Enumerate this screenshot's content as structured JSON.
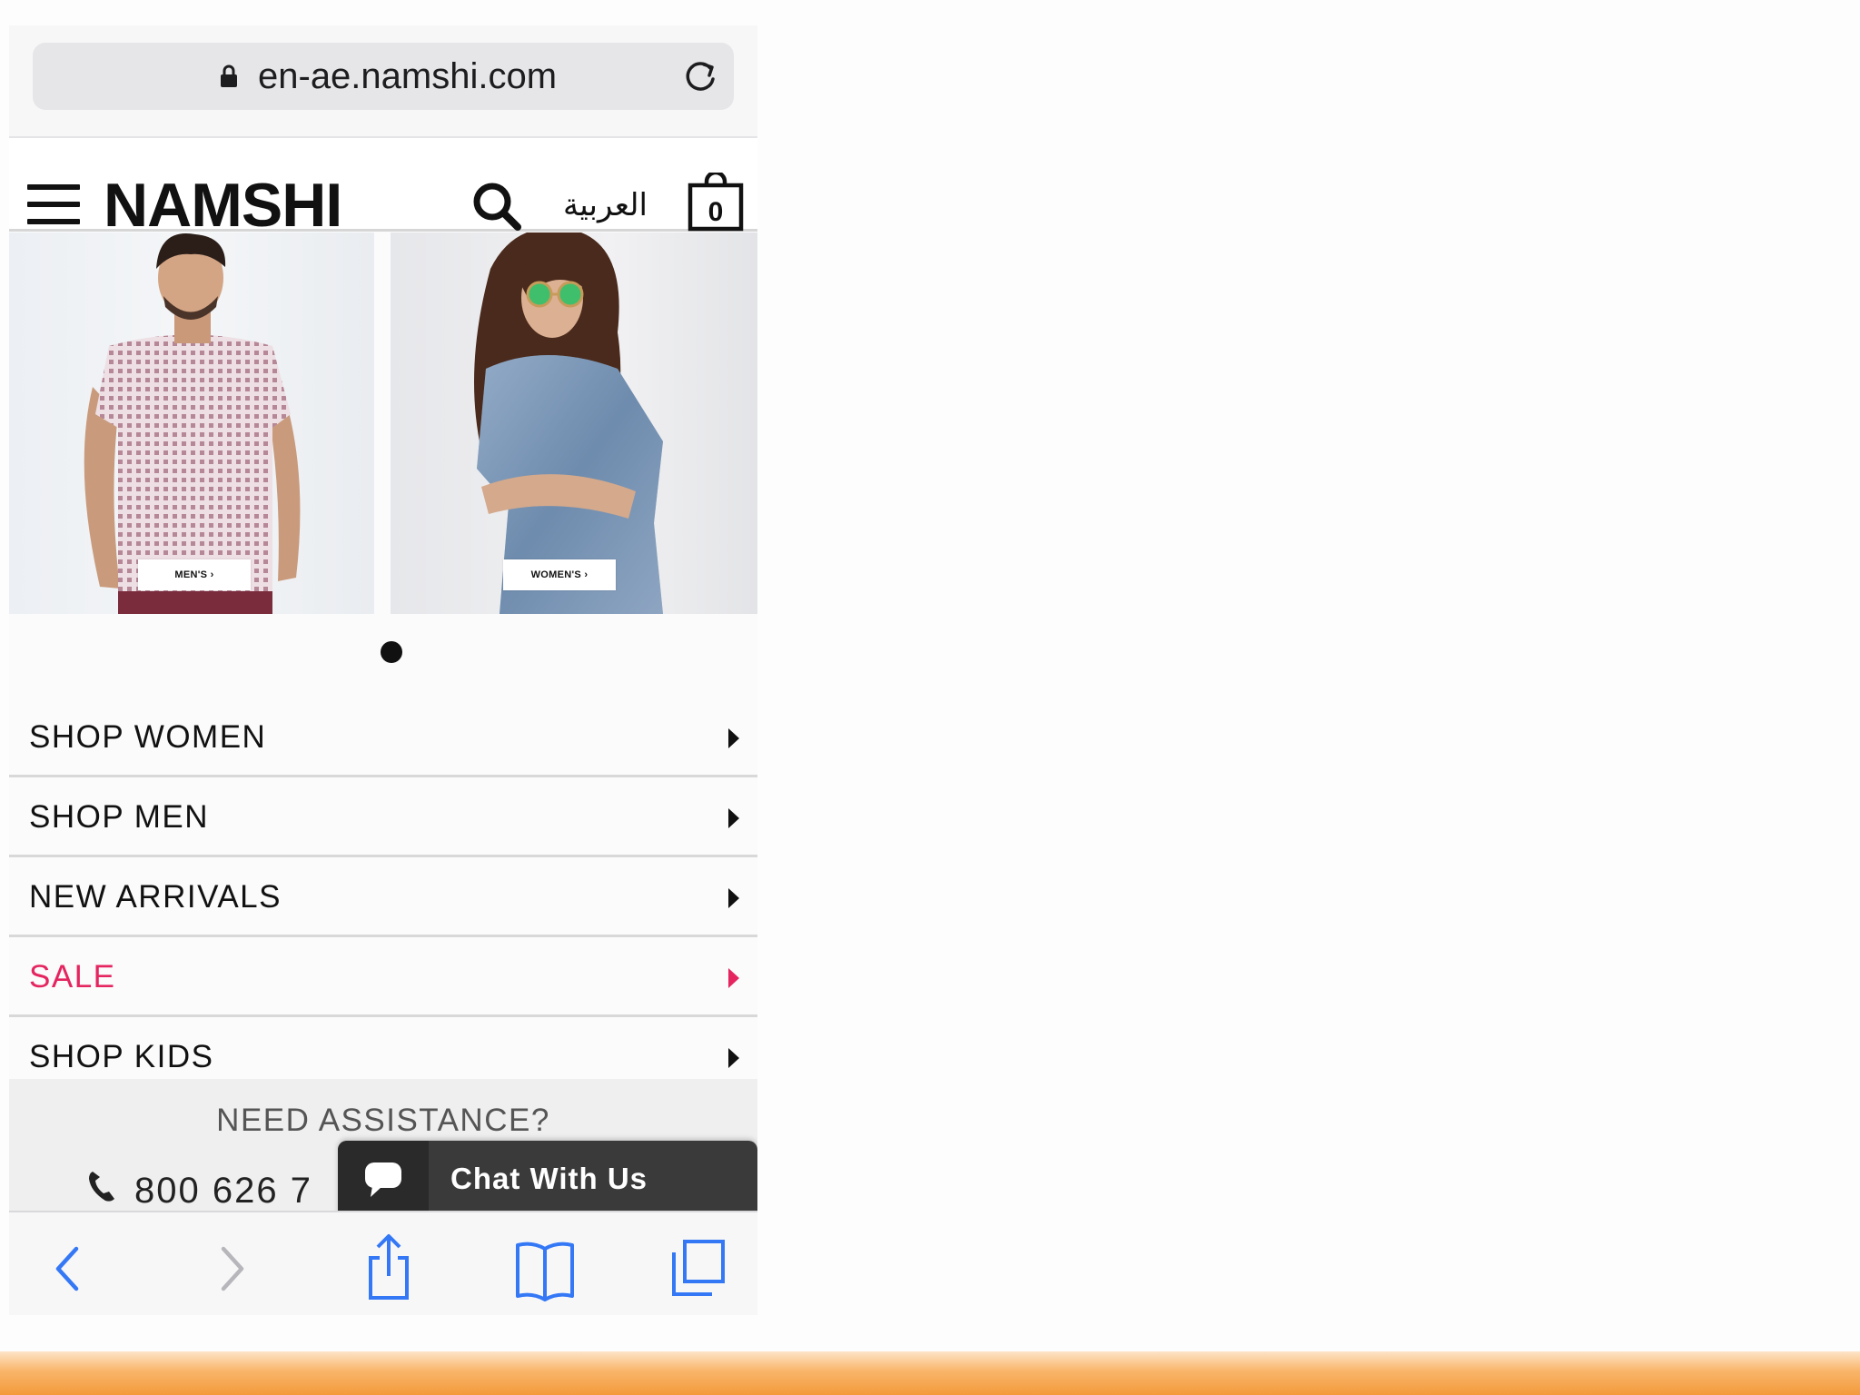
{
  "browser": {
    "url": "en-ae.namshi.com",
    "icons": {
      "lock": "lock-icon",
      "reload": "reload-icon"
    }
  },
  "header": {
    "logo": "NAMSHI",
    "language_link": "العربية",
    "bag_count": "0",
    "icons": {
      "menu": "hamburger-menu-icon",
      "search": "search-icon",
      "bag": "shopping-bag-icon"
    }
  },
  "banners": [
    {
      "button_label": "MEN'S ›"
    },
    {
      "button_label": "WOMEN'S ›"
    }
  ],
  "carousel": {
    "active_dot": 1,
    "dot_count": 1
  },
  "menu": {
    "items": [
      {
        "label": "SHOP WOMEN"
      },
      {
        "label": "SHOP MEN"
      },
      {
        "label": "NEW ARRIVALS"
      },
      {
        "label": "SALE"
      },
      {
        "label": "SHOP KIDS"
      }
    ]
  },
  "assistance": {
    "title": "NEED ASSISTANCE?",
    "phone": "800 626 7"
  },
  "chat": {
    "label": "Chat With Us"
  },
  "colors": {
    "sale": "#e5255f",
    "toolbar_icon": "#3478f6",
    "chat_bg": "#3a3a3a",
    "bottom_bar": "#f39a3c"
  },
  "toolbar": {
    "icons": [
      "back-icon",
      "forward-icon",
      "share-icon",
      "bookmarks-icon",
      "tabs-icon"
    ]
  }
}
